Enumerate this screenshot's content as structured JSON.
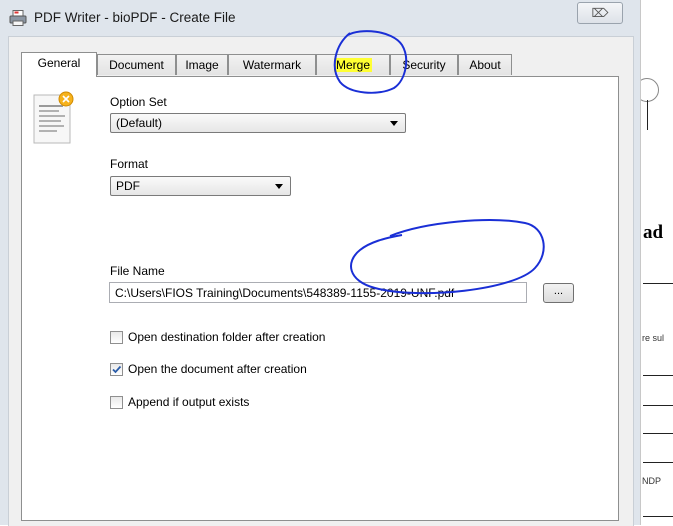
{
  "window": {
    "title": "PDF Writer - bioPDF - Create File",
    "close_label": "⌦"
  },
  "tabs": [
    {
      "label": "General",
      "active": true
    },
    {
      "label": "Document",
      "active": false
    },
    {
      "label": "Image",
      "active": false
    },
    {
      "label": "Watermark",
      "active": false
    },
    {
      "label": "Merge",
      "active": false
    },
    {
      "label": "Security",
      "active": false
    },
    {
      "label": "About",
      "active": false
    }
  ],
  "general": {
    "option_set": {
      "label": "Option Set",
      "value": "(Default)"
    },
    "format": {
      "label": "Format",
      "value": "PDF"
    },
    "file_name": {
      "label": "File Name",
      "value": "C:\\Users\\FIOS Training\\Documents\\548389-1155-2019-UNF.pdf"
    },
    "browse_label": "...",
    "checkboxes": [
      {
        "label": "Open destination folder after creation",
        "checked": false
      },
      {
        "label": "Open the document after creation",
        "checked": true
      },
      {
        "label": "Append if output exists",
        "checked": false
      }
    ]
  },
  "background_document": {
    "heading_fragment": "ad",
    "text_fragment_1": "re sul",
    "text_fragment_2": "NDP"
  },
  "colors": {
    "annotation_ink": "#1a2fd6",
    "merge_highlight": "#ffff33",
    "checkbox_tick": "#2a5ca8"
  },
  "icons": {
    "app": "pdf-printer-icon",
    "document": "document-gear-icon",
    "close": "close-x-icon"
  }
}
